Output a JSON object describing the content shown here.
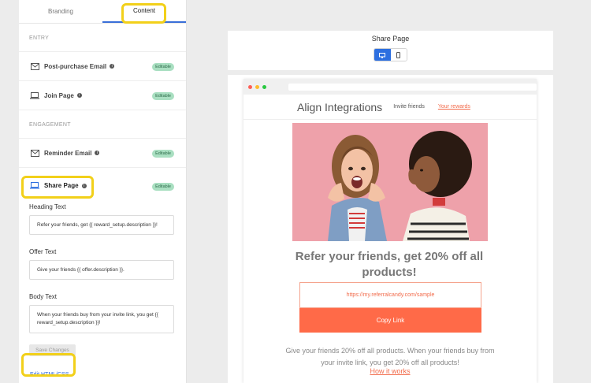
{
  "tabs": {
    "branding": "Branding",
    "content": "Content"
  },
  "sections": {
    "entry": "ENTRY",
    "engagement": "ENGAGEMENT"
  },
  "nav_items": {
    "post_purchase": {
      "label": "Post-purchase Email",
      "badge": "Editable",
      "icon": "mail-icon"
    },
    "join_page": {
      "label": "Join Page",
      "badge": "Editable",
      "icon": "laptop-icon"
    },
    "reminder": {
      "label": "Reminder Email",
      "badge": "Editable",
      "icon": "mail-icon"
    },
    "share_page": {
      "label": "Share Page",
      "badge": "Editable",
      "icon": "laptop-icon"
    }
  },
  "form": {
    "heading_label": "Heading Text",
    "heading_value": "Refer your friends, get {{ reward_setup.description }}!",
    "offer_label": "Offer Text",
    "offer_value": "Give your friends {{ offer.description }}.",
    "body_label": "Body Text",
    "body_value": "When your friends buy from your invite link, you get {{ reward_setup.description }}!",
    "save_label": "Save Changes",
    "edit_link": "Edit HTML/CSS"
  },
  "preview_header": {
    "title": "Share Page",
    "desktop_icon": "desktop-icon",
    "mobile_icon": "mobile-icon"
  },
  "preview": {
    "brand": "Align Integrations",
    "nav_invite": "Invite friends",
    "nav_rewards": "Your rewards",
    "headline": "Refer your friends, get 20% off all products!",
    "referral_link": "https://my.referralcandy.com/sample",
    "copy_button": "Copy Link",
    "body": "Give your friends 20% off all products. When your friends buy from your invite link, you get 20% off all products!",
    "how_it_works": "How it works"
  },
  "colors": {
    "accent": "#ff6a48",
    "highlight": "#f2d01a",
    "primary_blue": "#2d6fe0",
    "badge_bg": "#a9dfc1"
  }
}
